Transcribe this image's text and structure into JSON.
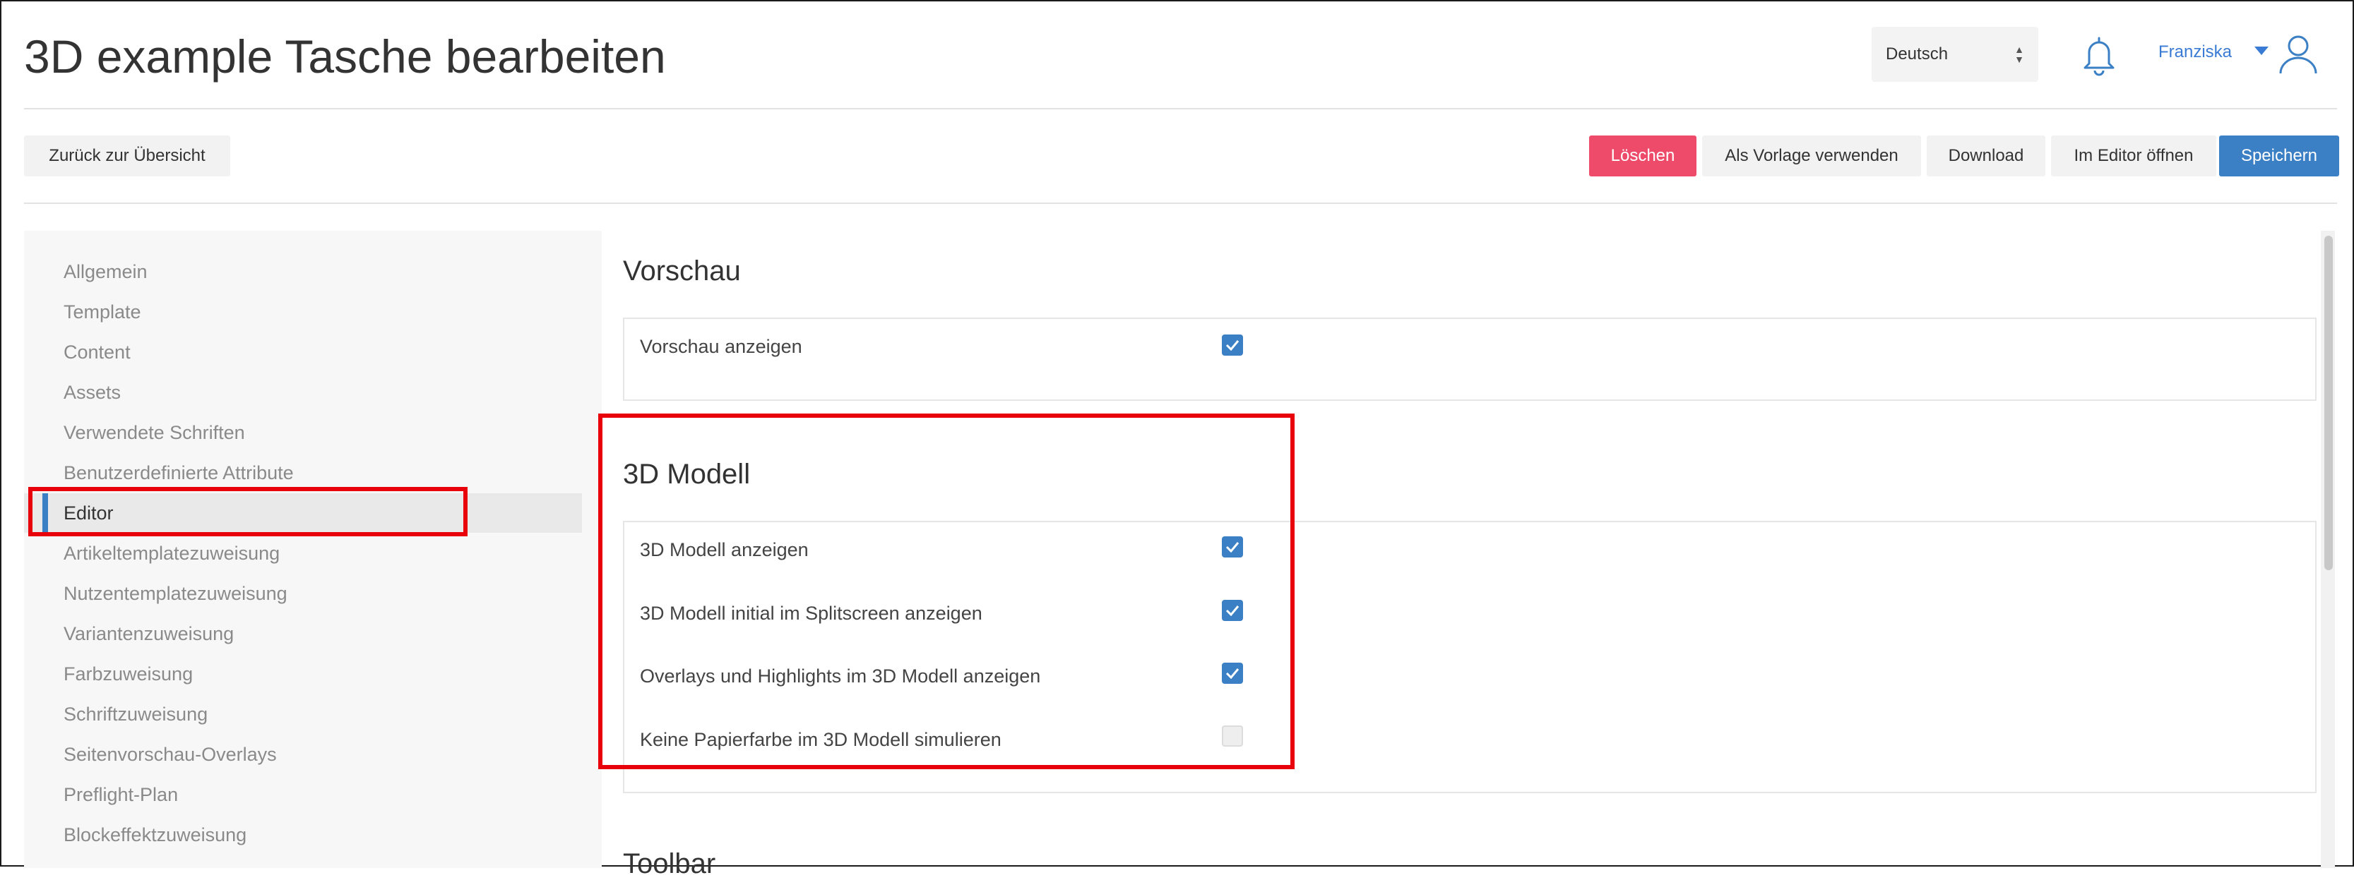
{
  "header": {
    "title": "3D example Tasche bearbeiten",
    "language": "Deutsch",
    "user_name": "Franziska"
  },
  "toolbar": {
    "back_label": "Zurück zur Übersicht",
    "delete_label": "Löschen",
    "use_template_label": "Als Vorlage verwenden",
    "download_label": "Download",
    "open_editor_label": "Im Editor öffnen",
    "save_label": "Speichern"
  },
  "sidebar": {
    "items": [
      {
        "label": "Allgemein"
      },
      {
        "label": "Template"
      },
      {
        "label": "Content"
      },
      {
        "label": "Assets"
      },
      {
        "label": "Verwendete Schriften"
      },
      {
        "label": "Benutzerdefinierte Attribute"
      },
      {
        "label": "Editor"
      },
      {
        "label": "Artikeltemplatezuweisung"
      },
      {
        "label": "Nutzentemplatezuweisung"
      },
      {
        "label": "Variantenzuweisung"
      },
      {
        "label": "Farbzuweisung"
      },
      {
        "label": "Schriftzuweisung"
      },
      {
        "label": "Seitenvorschau-Overlays"
      },
      {
        "label": "Preflight-Plan"
      },
      {
        "label": "Blockeffektzuweisung"
      }
    ],
    "active_item": "Editor"
  },
  "sections": {
    "preview": {
      "title": "Vorschau",
      "rows": [
        {
          "label": "Vorschau anzeigen",
          "checked": true
        }
      ]
    },
    "model3d": {
      "title": "3D Modell",
      "rows": [
        {
          "label": "3D Modell anzeigen",
          "checked": true
        },
        {
          "label": "3D Modell initial im Splitscreen anzeigen",
          "checked": true
        },
        {
          "label": "Overlays und Highlights im 3D Modell anzeigen",
          "checked": true
        },
        {
          "label": "Keine Papierfarbe im 3D Modell simulieren",
          "checked": false
        }
      ]
    },
    "toolbar_section": {
      "title": "Toolbar"
    }
  },
  "colors": {
    "accent": "#3b7fc4",
    "danger": "#ee4b6a",
    "annotation": "#e8000b",
    "link": "#3a7bd5"
  },
  "icons": {
    "bell": "bell-icon",
    "user": "user-icon",
    "check": "checkmark-icon",
    "caret": "caret-down-icon"
  }
}
